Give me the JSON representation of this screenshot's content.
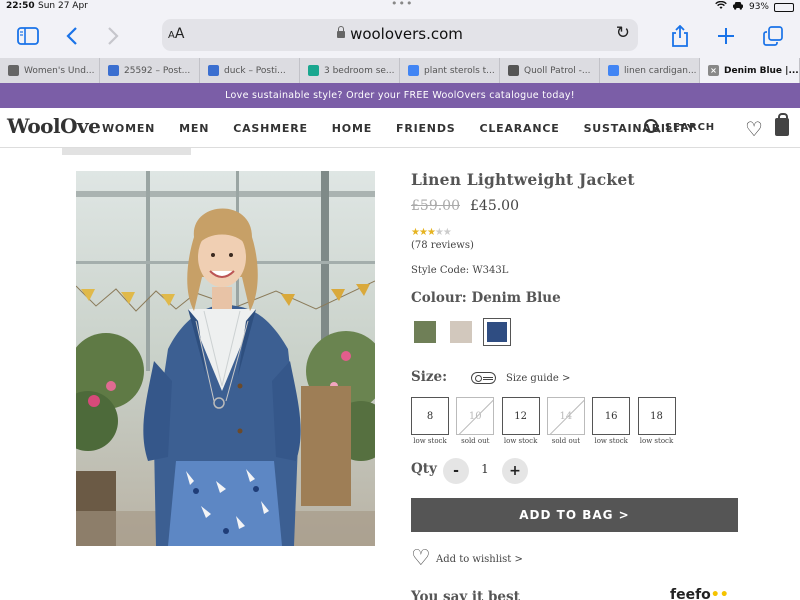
{
  "status_bar": {
    "time": "22:50",
    "date": "Sun 27 Apr",
    "battery": "93%",
    "battery_level": 0.93
  },
  "browser": {
    "url": "woolovers.com",
    "aa_label": "AA",
    "tabs": [
      {
        "label": "Women's Und...",
        "icon": "p-favicon",
        "color": "#666666"
      },
      {
        "label": "25592 – Post...",
        "icon": "p-favicon",
        "color": "#3b6fd0"
      },
      {
        "label": "duck – Posti...",
        "icon": "p-favicon",
        "color": "#3b6fd0"
      },
      {
        "label": "3 bedroom se...",
        "icon": "house-favicon",
        "color": "#1aa78f"
      },
      {
        "label": "plant sterols t...",
        "icon": "google-favicon",
        "color": "#4285f4"
      },
      {
        "label": "Quoll Patrol -...",
        "icon": "quoll-favicon",
        "color": "#555555"
      },
      {
        "label": "linen cardigan...",
        "icon": "google-favicon",
        "color": "#4285f4"
      },
      {
        "label": "Denim Blue |...",
        "icon": "close-favicon",
        "color": "#888888",
        "active": true
      }
    ]
  },
  "promo": {
    "text": "Love sustainable style? Order your FREE WoolOvers catalogue today!"
  },
  "nav": {
    "logo": "WoolOvers",
    "items": [
      "WOMEN",
      "MEN",
      "CASHMERE",
      "HOME",
      "FRIENDS",
      "CLEARANCE",
      "SUSTAINABILITY"
    ],
    "search_label": "SEARCH"
  },
  "product": {
    "title": "Linen Lightweight Jacket",
    "price_old": "£59.00",
    "price_new": "£45.00",
    "rating": 3,
    "rating_max": 5,
    "reviews": "(78 reviews)",
    "style_code": "Style Code: W343L",
    "colour_label": "Colour: Denim Blue",
    "colours": [
      {
        "name": "khaki",
        "hex": "#6f7f57"
      },
      {
        "name": "oatmeal",
        "hex": "#d2c8bd"
      },
      {
        "name": "denim-blue",
        "hex": "#2f4d82",
        "selected": true
      }
    ],
    "size_label": "Size:",
    "size_guide": "Size guide >",
    "sizes": [
      {
        "size": "8",
        "stock": "low stock",
        "available": true
      },
      {
        "size": "10",
        "stock": "sold out",
        "available": false
      },
      {
        "size": "12",
        "stock": "low stock",
        "available": true
      },
      {
        "size": "14",
        "stock": "sold out",
        "available": false
      },
      {
        "size": "16",
        "stock": "low stock",
        "available": true
      },
      {
        "size": "18",
        "stock": "low stock",
        "available": true
      }
    ],
    "qty_label": "Qty",
    "qty_minus": "-",
    "qty_plus": "+",
    "qty_value": "1",
    "add_to_bag": "ADD TO BAG  >",
    "wishlist": "Add to wishlist >",
    "reviews_heading": "You say it best",
    "feefo": "feefo"
  }
}
